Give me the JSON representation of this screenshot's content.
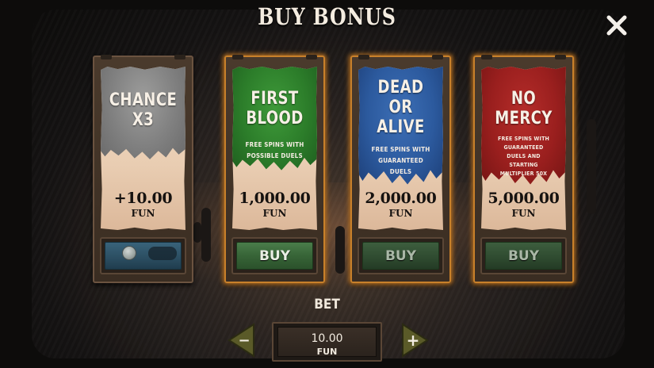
{
  "title": "BUY BONUS",
  "close": {
    "icon": "close-x-icon"
  },
  "cards": [
    {
      "title_lines": [
        "CHANCE",
        "X3"
      ],
      "description": "",
      "price": "+10.00",
      "currency": "FUN",
      "banner_color": "#808080",
      "button": {
        "type": "toggle",
        "icon": "coin-toggle-icon"
      }
    },
    {
      "title_lines": [
        "FIRST",
        "BLOOD"
      ],
      "description_lines": [
        "FREE SPINS WITH",
        "POSSIBLE DUELS"
      ],
      "price": "1,000.00",
      "currency": "FUN",
      "banner_color": "#2c7d2a",
      "button": {
        "label": "BUY"
      }
    },
    {
      "title_lines": [
        "DEAD",
        "OR",
        "ALIVE"
      ],
      "description_lines": [
        "FREE SPINS WITH",
        "GUARANTEED",
        "DUELS"
      ],
      "price": "2,000.00",
      "currency": "FUN",
      "banner_color": "#2c5a9e",
      "button": {
        "label": "BUY"
      }
    },
    {
      "title_lines": [
        "NO",
        "MERCY"
      ],
      "description_lines": [
        "FREE SPINS WITH",
        "GUARANTEED",
        "DUELS AND",
        "STARTING",
        "MULTIPLIER 50X"
      ],
      "price": "5,000.00",
      "currency": "FUN",
      "banner_color": "#9a1f1e",
      "button": {
        "label": "BUY"
      }
    }
  ],
  "bet": {
    "label": "BET",
    "value": "10.00",
    "currency": "FUN",
    "decrease_symbol": "−",
    "increase_symbol": "+"
  },
  "colors": {
    "accent_glow": "#c8802a",
    "button_green": "#376437"
  }
}
